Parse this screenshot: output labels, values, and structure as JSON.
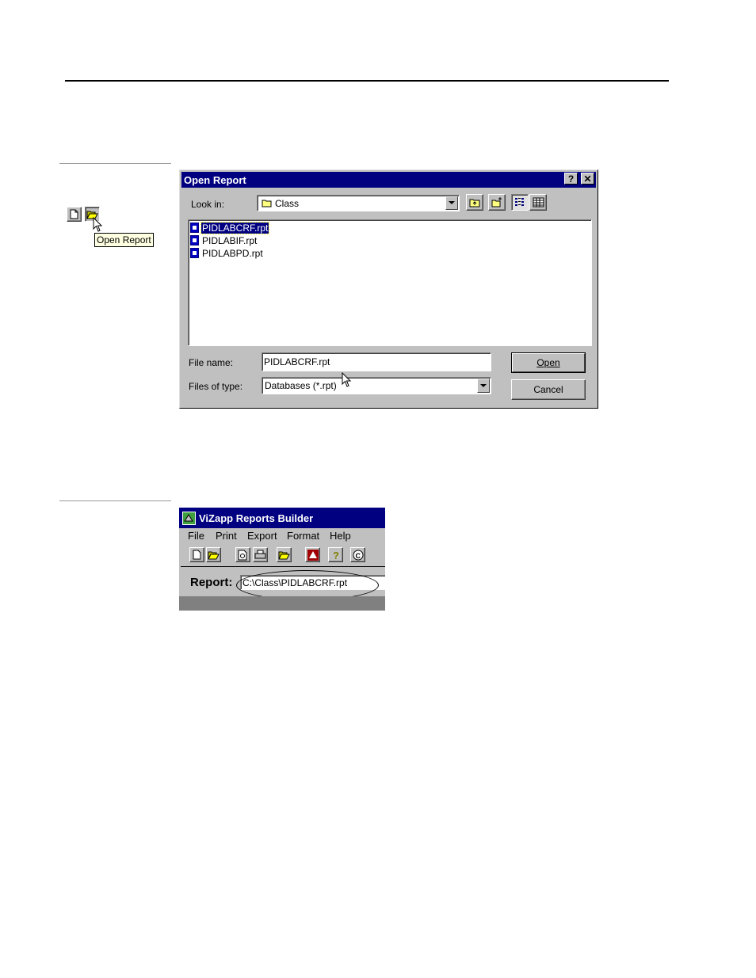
{
  "mini_toolbar": {
    "tooltip": "Open Report"
  },
  "open_dialog": {
    "title": "Open Report",
    "help_button": "?",
    "close_button": "✕",
    "look_in_label": "Look in:",
    "look_in_value": "Class",
    "files": [
      {
        "name": "PIDLABCRF.rpt",
        "selected": true
      },
      {
        "name": "PIDLABIF.rpt",
        "selected": false
      },
      {
        "name": "PIDLABPD.rpt",
        "selected": false
      }
    ],
    "file_name_label": "File name:",
    "file_name_value": "PIDLABCRF.rpt",
    "files_of_type_label": "Files of type:",
    "files_of_type_value": "Databases (*.rpt)",
    "open_button": "Open",
    "cancel_button": "Cancel"
  },
  "app": {
    "title": "ViZapp Reports Builder",
    "menu": [
      "File",
      "Print",
      "Export",
      "Format",
      "Help"
    ],
    "report_label": "Report:",
    "report_path": "C:\\Class\\PIDLABCRF.rpt"
  }
}
